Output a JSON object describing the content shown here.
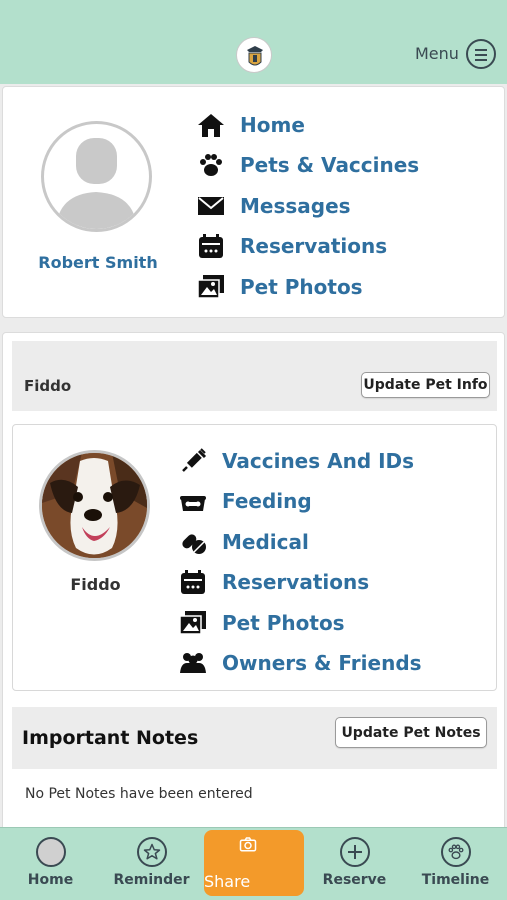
{
  "header": {
    "menu_label": "Menu",
    "logo_icon": "shield-logo-icon"
  },
  "profile": {
    "user_name": "Robert Smith",
    "nav": [
      {
        "label": "Home",
        "icon": "home-icon"
      },
      {
        "label": "Pets & Vaccines",
        "icon": "paw-icon"
      },
      {
        "label": "Messages",
        "icon": "envelope-icon"
      },
      {
        "label": "Reservations",
        "icon": "calendar-icon"
      },
      {
        "label": "Pet Photos",
        "icon": "photos-icon"
      }
    ]
  },
  "pet": {
    "header_name": "Fiddo",
    "update_info_label": "Update Pet Info",
    "name": "Fiddo",
    "nav": [
      {
        "label": "Vaccines And IDs",
        "icon": "syringe-icon"
      },
      {
        "label": "Feeding",
        "icon": "food-bowl-icon"
      },
      {
        "label": "Medical",
        "icon": "pills-icon"
      },
      {
        "label": "Reservations",
        "icon": "calendar-icon"
      },
      {
        "label": "Pet Photos",
        "icon": "photos-icon"
      },
      {
        "label": "Owners & Friends",
        "icon": "users-icon"
      }
    ]
  },
  "notes": {
    "title": "Important Notes",
    "update_label": "Update Pet Notes",
    "empty_text": "No Pet Notes have been entered"
  },
  "tabbar": {
    "tabs": [
      {
        "label": "Home",
        "icon": "home-circle-icon"
      },
      {
        "label": "Reminder",
        "icon": "star-icon"
      },
      {
        "label": "Share",
        "icon": "camera-icon"
      },
      {
        "label": "Reserve",
        "icon": "plus-icon"
      },
      {
        "label": "Timeline",
        "icon": "paw-icon"
      }
    ]
  },
  "colors": {
    "header_bg": "#b3e0cc",
    "link_blue": "#2f6f9f",
    "share_orange": "#f39a2a"
  }
}
